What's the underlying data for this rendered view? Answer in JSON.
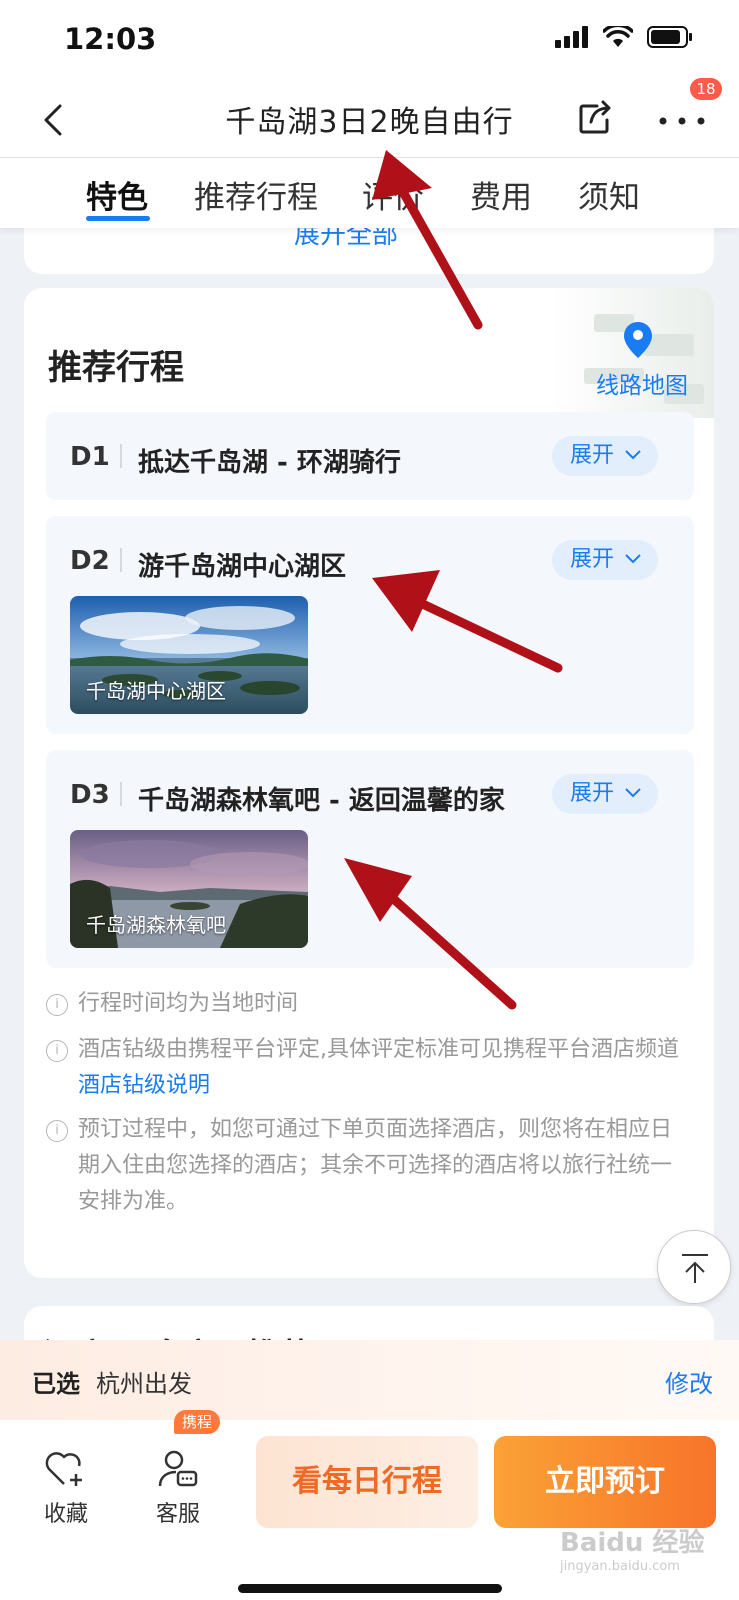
{
  "status_bar": {
    "time": "12:03"
  },
  "nav": {
    "title": "千岛湖3日2晚自由行",
    "badge_count": "18"
  },
  "tabs": [
    {
      "label": "特色",
      "active": true
    },
    {
      "label": "推荐行程",
      "active": false
    },
    {
      "label": "评价",
      "active": false
    },
    {
      "label": "费用",
      "active": false
    },
    {
      "label": "须知",
      "active": false
    }
  ],
  "top_card": {
    "expand_all": "展开全部"
  },
  "itinerary": {
    "title": "推荐行程",
    "map_link": "线路地图",
    "days": [
      {
        "day": "D1",
        "title": "抵达千岛湖 - 环湖骑行",
        "expand": "展开"
      },
      {
        "day": "D2",
        "title": "游千岛湖中心湖区",
        "expand": "展开",
        "photo_caption": "千岛湖中心湖区"
      },
      {
        "day": "D3",
        "title": "千岛湖森林氧吧 - 返回温馨的家",
        "expand": "展开",
        "photo_caption": "千岛湖森林氧吧"
      }
    ],
    "notes": [
      {
        "text": "行程时间均为当地时间"
      },
      {
        "text": "酒店钻级由携程平台评定,具体评定标准可见携程平台酒店频道",
        "link": "酒店钻级说明"
      },
      {
        "text": "预订过程中，如您可通过下单页面选择酒店，则您将在相应日期入住由您选择的酒店；其余不可选择的酒店将以旅行社统一安排为准。"
      }
    ]
  },
  "next_card": {
    "title": "酒店 更多产品推荐"
  },
  "selected": {
    "label": "已选",
    "value": "杭州出发",
    "modify": "修改"
  },
  "bottom": {
    "favorite": "收藏",
    "service": "客服",
    "service_badge": "携程",
    "daily_button": "看每日行程",
    "book_button": "立即预订"
  },
  "watermark": {
    "brand": "Baidu 经验",
    "url": "jingyan.baidu.com"
  },
  "colors": {
    "accent_blue": "#1a7cf2",
    "orange": "#f7742a",
    "badge_red": "#ff5a4a",
    "annotation_red": "#b01018"
  }
}
